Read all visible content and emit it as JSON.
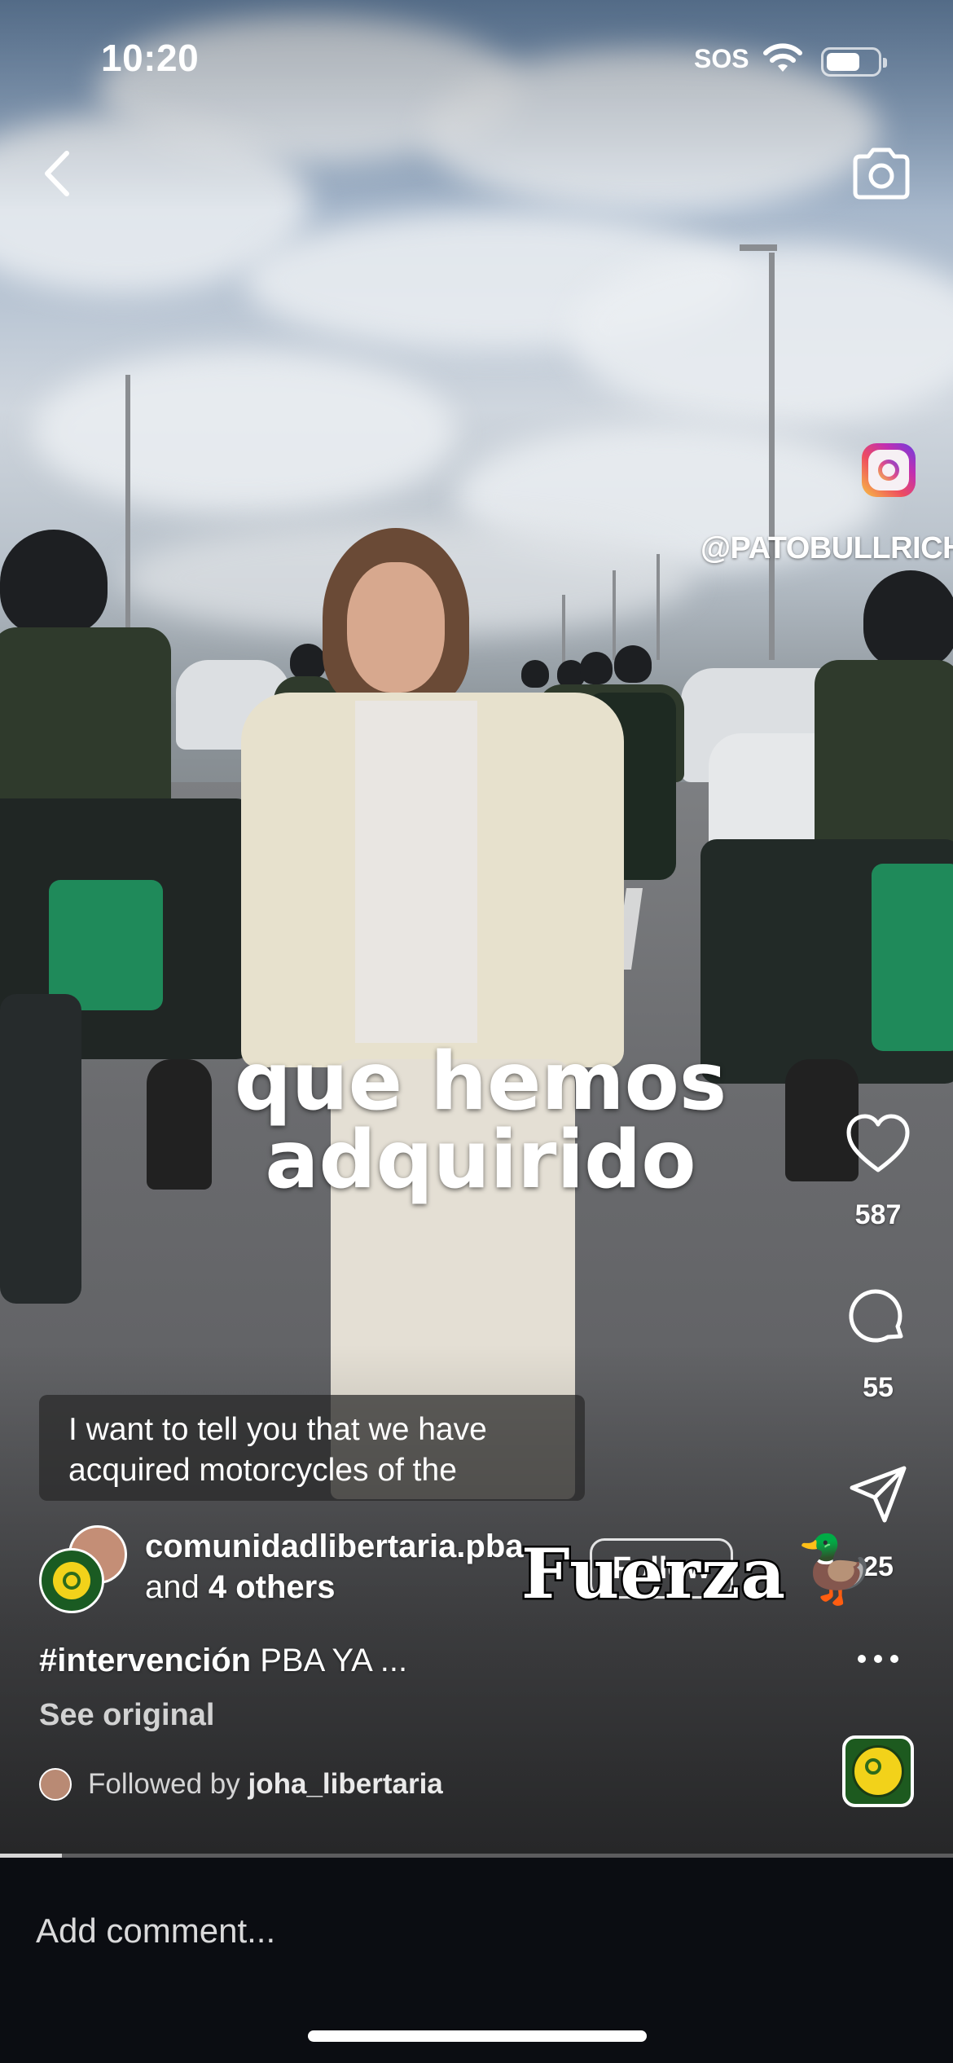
{
  "status_bar": {
    "time": "10:20",
    "sos": "SOS",
    "battery_level": 0.65
  },
  "video": {
    "watermark_handle": "@PATOBULLRICH",
    "caption_text": "que hemos adquirido",
    "translation": "I want to tell you that we have acquired motorcycles of the",
    "overlay_word": "Fuerza",
    "progress": 0.065
  },
  "actions": {
    "likes": "587",
    "comments": "55",
    "shares": "25"
  },
  "post": {
    "author": "comunidadlibertaria.pba",
    "others_prefix": "and",
    "others_count": "4 others",
    "follow_label": "Follow",
    "hashtag": "#intervención",
    "caption_rest": "PBA YA ...",
    "see_original": "See original",
    "followed_by_prefix": "Followed by",
    "followed_by_user": "joha_libertaria"
  },
  "comment_bar": {
    "placeholder": "Add comment..."
  },
  "icons": [
    "back-icon",
    "camera-icon",
    "heart-icon",
    "comment-icon",
    "share-icon",
    "more-icon",
    "instagram-logo-icon",
    "wifi-icon",
    "battery-icon"
  ],
  "colors": {
    "background": "#0b0d12",
    "text": "#ffffff",
    "ig_gradient_start": "#f7c043",
    "ig_gradient_end": "#6a3ee0",
    "badge_yellow": "#f2d21a"
  }
}
